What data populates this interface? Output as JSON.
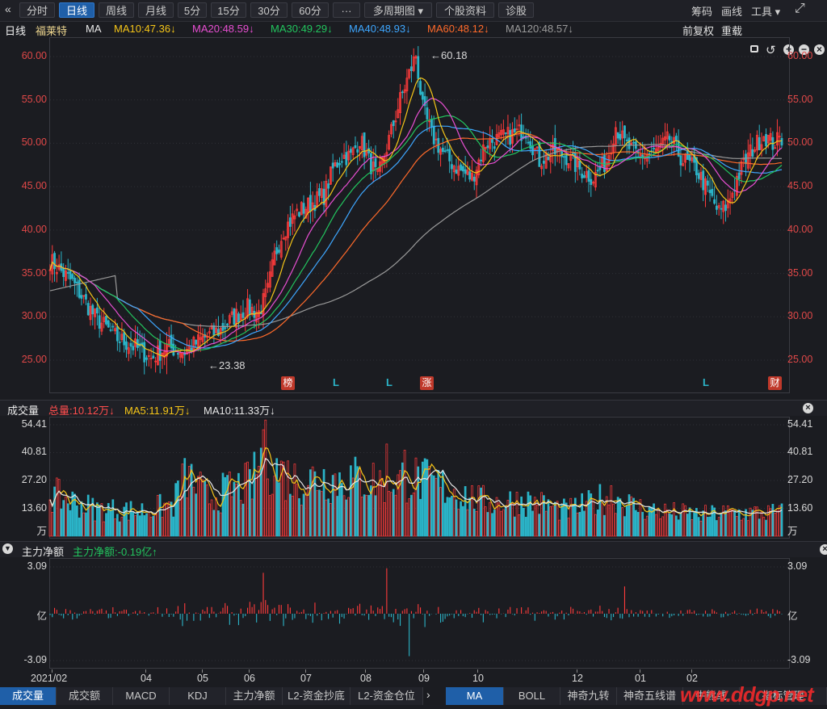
{
  "toolbar": {
    "back_glyph": "«",
    "tabs": [
      "分时",
      "日线",
      "周线",
      "月线",
      "5分",
      "15分",
      "30分",
      "60分",
      "···",
      "多周期图 ▾",
      "个股资料",
      "诊股"
    ],
    "active_tab": "日线",
    "right": [
      "筹码",
      "画线",
      "工具 ▾"
    ],
    "expand_glyph": "⤢"
  },
  "ma_row": {
    "period": "日线",
    "stock_name": "福莱特",
    "ma_label": "MA",
    "items": [
      {
        "text": "MA10:47.36↓",
        "color": "#f5c518"
      },
      {
        "text": "MA20:48.59↓",
        "color": "#e84fd2"
      },
      {
        "text": "MA30:49.29↓",
        "color": "#22c55e"
      },
      {
        "text": "MA40:48.93↓",
        "color": "#3ea7ff"
      },
      {
        "text": "MA60:48.12↓",
        "color": "#ff6a2a"
      },
      {
        "text": "MA120:48.57↓",
        "color": "#9a9a9a"
      }
    ],
    "right": [
      "前复权",
      "重载"
    ]
  },
  "price_axis": {
    "ticks": [
      "60.00",
      "55.00",
      "50.00",
      "45.00",
      "40.00",
      "35.00",
      "30.00",
      "25.00"
    ],
    "color": "#e04848"
  },
  "annotations": {
    "high": "←60.18",
    "low": "←23.38"
  },
  "event_flags": [
    {
      "text": "榜",
      "type": "flag"
    },
    {
      "text": "L",
      "type": "l"
    },
    {
      "text": "L",
      "type": "l"
    },
    {
      "text": "涨",
      "type": "flag"
    },
    {
      "text": "L",
      "type": "l"
    },
    {
      "text": "财",
      "type": "flag"
    }
  ],
  "volume_panel": {
    "title": "成交量",
    "items": [
      {
        "text": "总量:10.12万↓",
        "color": "#ff4d4d"
      },
      {
        "text": "MA5:11.91万↓",
        "color": "#f5c518"
      },
      {
        "text": "MA10:11.33万↓",
        "color": "#e6e6e6"
      }
    ],
    "ticks": [
      "54.41",
      "40.81",
      "27.20",
      "13.60",
      "万"
    ]
  },
  "flow_panel": {
    "title": "主力净额",
    "item": {
      "text": "主力净额:-0.19亿↑",
      "color": "#22c55e"
    },
    "ticks": [
      "3.09",
      "亿",
      "-3.09"
    ]
  },
  "x_axis": {
    "labels": [
      "2021/02",
      "04",
      "05",
      "06",
      "07",
      "08",
      "09",
      "10",
      "12",
      "01",
      "02"
    ]
  },
  "bottom_tabs_left": [
    "成交量",
    "成交额",
    "MACD",
    "KDJ",
    "主力净额",
    "L2-资金抄底",
    "L2-资金仓位"
  ],
  "bottom_tabs_right": [
    "MA",
    "BOLL",
    "神奇九转",
    "神奇五线谱",
    "牛熊线",
    "指标管理"
  ],
  "active_bottom_left": "成交量",
  "active_bottom_right": "MA",
  "watermark": "www.ddgp.net",
  "chart_data": {
    "type": "candlestick",
    "title": "",
    "price_range": [
      22,
      62
    ],
    "annotated_high": 60.18,
    "annotated_low": 23.38,
    "close_keypoints": [
      [
        0,
        36.5
      ],
      [
        10,
        34
      ],
      [
        20,
        30
      ],
      [
        30,
        27.5
      ],
      [
        38,
        26.5
      ],
      [
        45,
        25.2
      ],
      [
        52,
        26.5
      ],
      [
        60,
        26
      ],
      [
        68,
        27.5
      ],
      [
        76,
        28.5
      ],
      [
        82,
        30
      ],
      [
        88,
        31
      ],
      [
        93,
        30.5
      ],
      [
        97,
        33
      ],
      [
        100,
        37
      ],
      [
        104,
        40
      ],
      [
        110,
        42
      ],
      [
        116,
        43
      ],
      [
        122,
        44
      ],
      [
        126,
        47
      ],
      [
        130,
        48.5
      ],
      [
        134,
        48.5
      ],
      [
        138,
        50.5
      ],
      [
        142,
        48
      ],
      [
        146,
        46
      ],
      [
        150,
        49.5
      ],
      [
        156,
        55
      ],
      [
        160,
        58
      ],
      [
        163,
        60.18
      ],
      [
        166,
        54
      ],
      [
        170,
        51
      ],
      [
        176,
        48.5
      ],
      [
        182,
        47
      ],
      [
        188,
        46
      ],
      [
        194,
        50
      ],
      [
        200,
        50.5
      ],
      [
        206,
        51
      ],
      [
        212,
        51.5
      ],
      [
        218,
        48
      ],
      [
        224,
        49
      ],
      [
        230,
        48.5
      ],
      [
        236,
        47
      ],
      [
        242,
        46
      ],
      [
        248,
        48
      ],
      [
        252,
        52
      ],
      [
        256,
        50
      ],
      [
        262,
        48.5
      ],
      [
        270,
        49
      ],
      [
        276,
        50.5
      ],
      [
        282,
        48
      ],
      [
        288,
        47
      ],
      [
        294,
        44
      ],
      [
        298,
        42
      ],
      [
        302,
        43
      ],
      [
        306,
        46
      ],
      [
        312,
        49
      ],
      [
        318,
        51
      ],
      [
        322,
        50
      ],
      [
        326,
        50.5
      ]
    ],
    "moving_averages": {
      "MA10": 47.36,
      "MA20": 48.59,
      "MA30": 49.29,
      "MA40": 48.93,
      "MA60": 48.12,
      "MA120": 48.57
    },
    "volume_range": [
      0,
      54.41
    ],
    "volume_unit": "万",
    "volume_keypoints": [
      [
        0,
        20
      ],
      [
        20,
        13
      ],
      [
        40,
        12
      ],
      [
        55,
        15
      ],
      [
        60,
        30
      ],
      [
        70,
        18
      ],
      [
        80,
        22
      ],
      [
        90,
        25
      ],
      [
        95,
        40
      ],
      [
        100,
        32
      ],
      [
        110,
        26
      ],
      [
        120,
        28
      ],
      [
        130,
        27
      ],
      [
        140,
        27
      ],
      [
        150,
        26
      ],
      [
        160,
        28
      ],
      [
        170,
        25
      ],
      [
        180,
        22
      ],
      [
        190,
        17
      ],
      [
        200,
        16
      ],
      [
        210,
        17
      ],
      [
        220,
        15
      ],
      [
        230,
        12
      ],
      [
        240,
        15
      ],
      [
        250,
        20
      ],
      [
        260,
        14
      ],
      [
        270,
        12
      ],
      [
        280,
        11
      ],
      [
        290,
        10
      ],
      [
        300,
        11
      ],
      [
        310,
        11
      ],
      [
        326,
        11
      ]
    ],
    "flow_range": [
      -3.09,
      3.09
    ],
    "flow_unit": "亿"
  }
}
